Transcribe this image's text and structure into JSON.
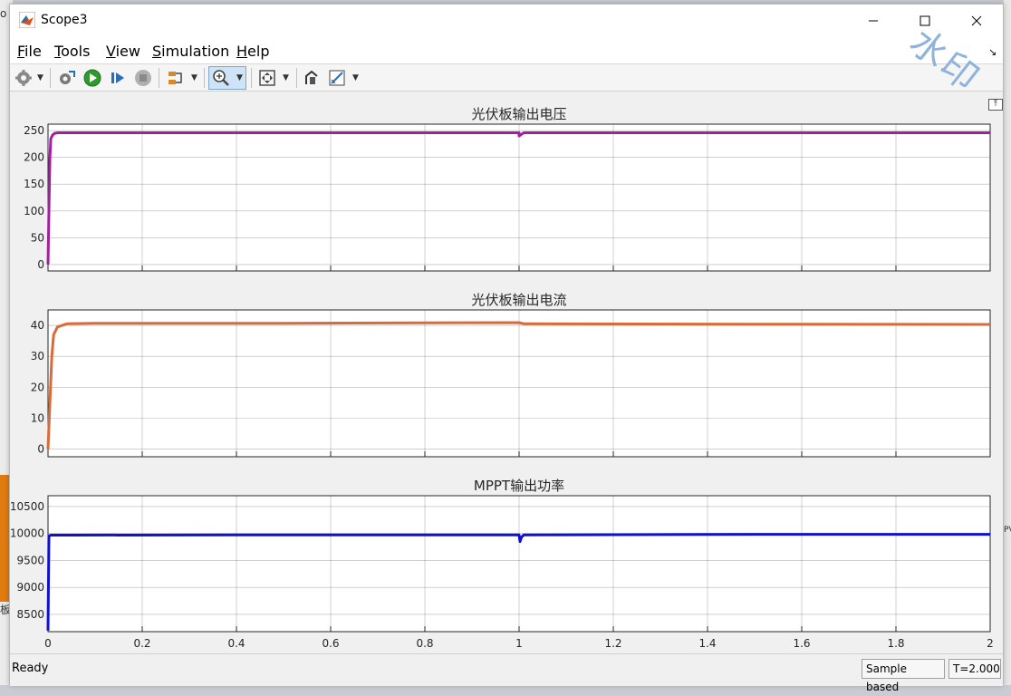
{
  "window": {
    "title": "Scope3"
  },
  "menu": [
    {
      "label": "File",
      "accel": "F",
      "rest": "ile"
    },
    {
      "label": "Tools",
      "accel": "T",
      "rest": "ools"
    },
    {
      "label": "View",
      "accel": "V",
      "rest": "iew"
    },
    {
      "label": "Simulation",
      "accel": "S",
      "rest": "imulation"
    },
    {
      "label": "Help",
      "accel": "H",
      "rest": "elp"
    }
  ],
  "toolbar": {
    "icons": [
      "gear-icon",
      "parameters-icon",
      "run-icon",
      "step-forward-icon",
      "stop-icon",
      "signal-selector-icon",
      "zoom-in-icon",
      "fit-to-view-icon",
      "highlight-block-icon",
      "measure-icon"
    ]
  },
  "watermark": "水印",
  "background_fragments": {
    "left_top": "o",
    "left_mid": "板",
    "right_mid": "PV"
  },
  "chart_data": [
    {
      "type": "line",
      "title": "光伏板输出电压",
      "x_range": [
        0,
        2
      ],
      "ylim": [
        -12,
        262
      ],
      "yticks": [
        0,
        50,
        100,
        150,
        200,
        250
      ],
      "grid": true,
      "color": "#a020a0",
      "series": [
        {
          "x": [
            0,
            0.002,
            0.004,
            0.006,
            0.01,
            0.014,
            0.02,
            0.1,
            0.5,
            1.0,
            1.0,
            1.005,
            1.01,
            1.5,
            2.0
          ],
          "y": [
            0,
            100,
            200,
            235,
            242,
            245,
            246,
            246,
            246,
            246,
            240,
            243,
            246,
            246,
            246
          ]
        }
      ]
    },
    {
      "type": "line",
      "title": "光伏板输出电流",
      "x_range": [
        0,
        2
      ],
      "ylim": [
        -2.5,
        45
      ],
      "yticks": [
        0,
        10,
        20,
        30,
        40
      ],
      "grid": true,
      "color": "#d76b3a",
      "series": [
        {
          "x": [
            0,
            0.004,
            0.008,
            0.012,
            0.02,
            0.04,
            0.1,
            0.5,
            1.0,
            1.01,
            1.5,
            2.0
          ],
          "y": [
            0,
            15,
            30,
            37,
            39.5,
            40.5,
            40.7,
            40.7,
            40.9,
            40.5,
            40.4,
            40.3
          ]
        }
      ]
    },
    {
      "type": "line",
      "title": "MPPT输出功率",
      "x_range": [
        0,
        2
      ],
      "xticks": [
        0,
        0.2,
        0.4,
        0.6,
        0.8,
        1,
        1.2,
        1.4,
        1.6,
        1.8,
        2
      ],
      "xticklabels": [
        "0",
        "0.2",
        "0.4",
        "0.6",
        "0.8",
        "1",
        "1.2",
        "1.4",
        "1.6",
        "1.8",
        "2"
      ],
      "ylim": [
        8180,
        10700
      ],
      "yticks": [
        8500,
        9000,
        9500,
        10000,
        10500
      ],
      "yticklabels": [
        "8500",
        "9000",
        "9500",
        "10000",
        "10500"
      ],
      "grid": true,
      "color": "#1010d0",
      "series": [
        {
          "x": [
            0,
            0.002,
            0.004,
            0.006,
            0.05,
            0.5,
            1.0,
            1.002,
            1.005,
            1.01,
            1.5,
            2.0
          ],
          "y": [
            8200,
            9950,
            9960,
            9970,
            9970,
            9975,
            9975,
            9850,
            9930,
            9975,
            9985,
            9985
          ]
        }
      ]
    }
  ],
  "status": {
    "ready": "Ready",
    "mode": "Sample based",
    "time": "T=2.000"
  }
}
